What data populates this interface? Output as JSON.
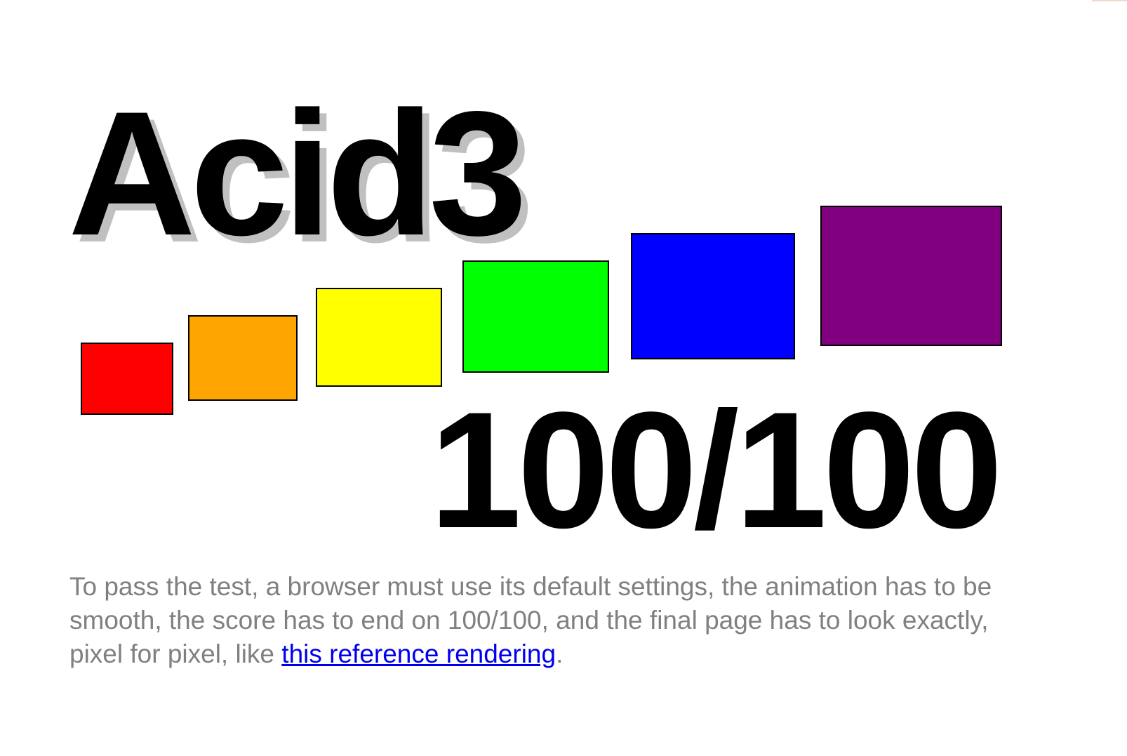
{
  "title": "Acid3",
  "score": "100/100",
  "colors": {
    "bucket1": "#ff0000",
    "bucket2": "#ffa500",
    "bucket3": "#ffff00",
    "bucket4": "#00ff00",
    "bucket5": "#0000ff",
    "bucket6": "#800080",
    "title_shadow": "#c0c0c0",
    "instructions_text": "#808080",
    "link": "#0000ee"
  },
  "instructions": {
    "text_before_link": "To pass the test, a browser must use its default settings, the animation has to be smooth, the score has to end on 100/100, and the final page has to look exactly, pixel for pixel, like ",
    "link_text": "this reference rendering",
    "text_after_link": "."
  }
}
